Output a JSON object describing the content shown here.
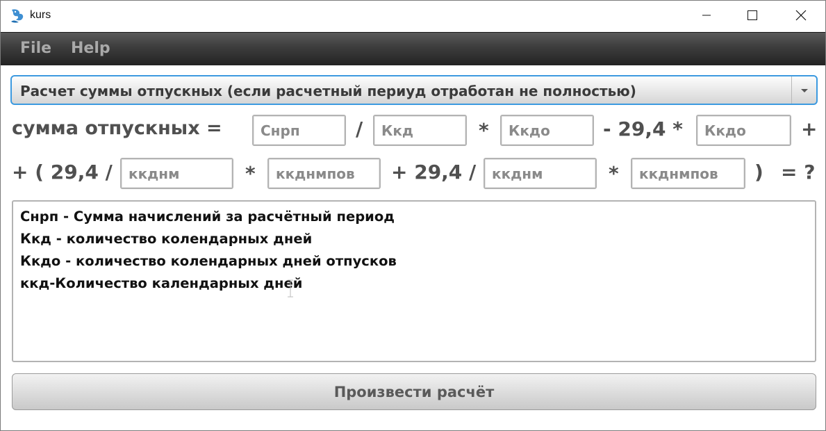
{
  "window": {
    "title": "kurs",
    "controls": {
      "minimize": "minimize-icon",
      "maximize": "maximize-icon",
      "close": "close-icon"
    }
  },
  "menu": {
    "file": "File",
    "help": "Help"
  },
  "mode_select": {
    "selected": "Расчет суммы отпускных (если расчетный периуд отработан не полностью)"
  },
  "formula": {
    "row1": {
      "lhs": "сумма отпускных =",
      "div": "/",
      "mul": "*",
      "minus_const": "- 29,4 *",
      "plus": "+"
    },
    "row2": {
      "open": "+ ( 29,4 /",
      "mul1": "*",
      "plus_const": "+ 29,4 /",
      "mul2": "*",
      "close": ")",
      "result": "= ?"
    },
    "fields": {
      "snrp": "Снрп",
      "kkd": "Ккд",
      "kkdo1": "Ккдо",
      "kkdo2": "Ккдо",
      "kkdnm1": "ккднм",
      "kkdnmpov1": "ккднмпов",
      "kkdnm2": "ккднм",
      "kkdnmpov2": "ккднмпов"
    }
  },
  "legend": [
    "Снрп - Сумма начислений за расчётный период",
    "Ккд - количество колендарных дней",
    "Ккдо - количество колендарных дней отпусков",
    "ккд-Количество календарных дней"
  ],
  "calculate_button": "Произвести расчёт"
}
